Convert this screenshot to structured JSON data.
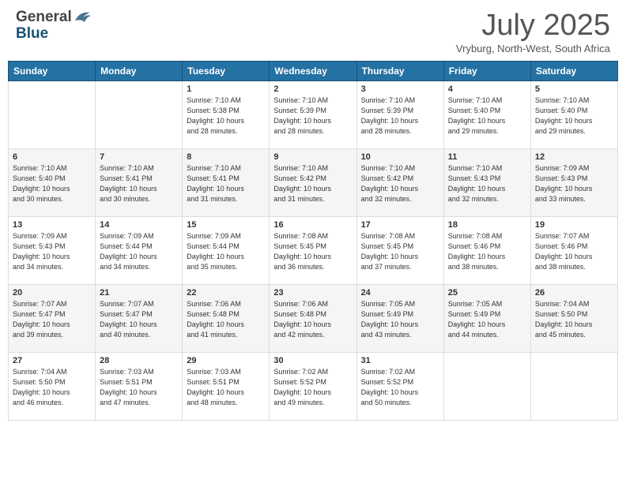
{
  "header": {
    "logo_general": "General",
    "logo_blue": "Blue",
    "month_year": "July 2025",
    "location": "Vryburg, North-West, South Africa"
  },
  "days_of_week": [
    "Sunday",
    "Monday",
    "Tuesday",
    "Wednesday",
    "Thursday",
    "Friday",
    "Saturday"
  ],
  "weeks": [
    [
      {
        "day": "",
        "info": ""
      },
      {
        "day": "",
        "info": ""
      },
      {
        "day": "1",
        "info": "Sunrise: 7:10 AM\nSunset: 5:38 PM\nDaylight: 10 hours\nand 28 minutes."
      },
      {
        "day": "2",
        "info": "Sunrise: 7:10 AM\nSunset: 5:39 PM\nDaylight: 10 hours\nand 28 minutes."
      },
      {
        "day": "3",
        "info": "Sunrise: 7:10 AM\nSunset: 5:39 PM\nDaylight: 10 hours\nand 28 minutes."
      },
      {
        "day": "4",
        "info": "Sunrise: 7:10 AM\nSunset: 5:40 PM\nDaylight: 10 hours\nand 29 minutes."
      },
      {
        "day": "5",
        "info": "Sunrise: 7:10 AM\nSunset: 5:40 PM\nDaylight: 10 hours\nand 29 minutes."
      }
    ],
    [
      {
        "day": "6",
        "info": "Sunrise: 7:10 AM\nSunset: 5:40 PM\nDaylight: 10 hours\nand 30 minutes."
      },
      {
        "day": "7",
        "info": "Sunrise: 7:10 AM\nSunset: 5:41 PM\nDaylight: 10 hours\nand 30 minutes."
      },
      {
        "day": "8",
        "info": "Sunrise: 7:10 AM\nSunset: 5:41 PM\nDaylight: 10 hours\nand 31 minutes."
      },
      {
        "day": "9",
        "info": "Sunrise: 7:10 AM\nSunset: 5:42 PM\nDaylight: 10 hours\nand 31 minutes."
      },
      {
        "day": "10",
        "info": "Sunrise: 7:10 AM\nSunset: 5:42 PM\nDaylight: 10 hours\nand 32 minutes."
      },
      {
        "day": "11",
        "info": "Sunrise: 7:10 AM\nSunset: 5:43 PM\nDaylight: 10 hours\nand 32 minutes."
      },
      {
        "day": "12",
        "info": "Sunrise: 7:09 AM\nSunset: 5:43 PM\nDaylight: 10 hours\nand 33 minutes."
      }
    ],
    [
      {
        "day": "13",
        "info": "Sunrise: 7:09 AM\nSunset: 5:43 PM\nDaylight: 10 hours\nand 34 minutes."
      },
      {
        "day": "14",
        "info": "Sunrise: 7:09 AM\nSunset: 5:44 PM\nDaylight: 10 hours\nand 34 minutes."
      },
      {
        "day": "15",
        "info": "Sunrise: 7:09 AM\nSunset: 5:44 PM\nDaylight: 10 hours\nand 35 minutes."
      },
      {
        "day": "16",
        "info": "Sunrise: 7:08 AM\nSunset: 5:45 PM\nDaylight: 10 hours\nand 36 minutes."
      },
      {
        "day": "17",
        "info": "Sunrise: 7:08 AM\nSunset: 5:45 PM\nDaylight: 10 hours\nand 37 minutes."
      },
      {
        "day": "18",
        "info": "Sunrise: 7:08 AM\nSunset: 5:46 PM\nDaylight: 10 hours\nand 38 minutes."
      },
      {
        "day": "19",
        "info": "Sunrise: 7:07 AM\nSunset: 5:46 PM\nDaylight: 10 hours\nand 38 minutes."
      }
    ],
    [
      {
        "day": "20",
        "info": "Sunrise: 7:07 AM\nSunset: 5:47 PM\nDaylight: 10 hours\nand 39 minutes."
      },
      {
        "day": "21",
        "info": "Sunrise: 7:07 AM\nSunset: 5:47 PM\nDaylight: 10 hours\nand 40 minutes."
      },
      {
        "day": "22",
        "info": "Sunrise: 7:06 AM\nSunset: 5:48 PM\nDaylight: 10 hours\nand 41 minutes."
      },
      {
        "day": "23",
        "info": "Sunrise: 7:06 AM\nSunset: 5:48 PM\nDaylight: 10 hours\nand 42 minutes."
      },
      {
        "day": "24",
        "info": "Sunrise: 7:05 AM\nSunset: 5:49 PM\nDaylight: 10 hours\nand 43 minutes."
      },
      {
        "day": "25",
        "info": "Sunrise: 7:05 AM\nSunset: 5:49 PM\nDaylight: 10 hours\nand 44 minutes."
      },
      {
        "day": "26",
        "info": "Sunrise: 7:04 AM\nSunset: 5:50 PM\nDaylight: 10 hours\nand 45 minutes."
      }
    ],
    [
      {
        "day": "27",
        "info": "Sunrise: 7:04 AM\nSunset: 5:50 PM\nDaylight: 10 hours\nand 46 minutes."
      },
      {
        "day": "28",
        "info": "Sunrise: 7:03 AM\nSunset: 5:51 PM\nDaylight: 10 hours\nand 47 minutes."
      },
      {
        "day": "29",
        "info": "Sunrise: 7:03 AM\nSunset: 5:51 PM\nDaylight: 10 hours\nand 48 minutes."
      },
      {
        "day": "30",
        "info": "Sunrise: 7:02 AM\nSunset: 5:52 PM\nDaylight: 10 hours\nand 49 minutes."
      },
      {
        "day": "31",
        "info": "Sunrise: 7:02 AM\nSunset: 5:52 PM\nDaylight: 10 hours\nand 50 minutes."
      },
      {
        "day": "",
        "info": ""
      },
      {
        "day": "",
        "info": ""
      }
    ]
  ]
}
